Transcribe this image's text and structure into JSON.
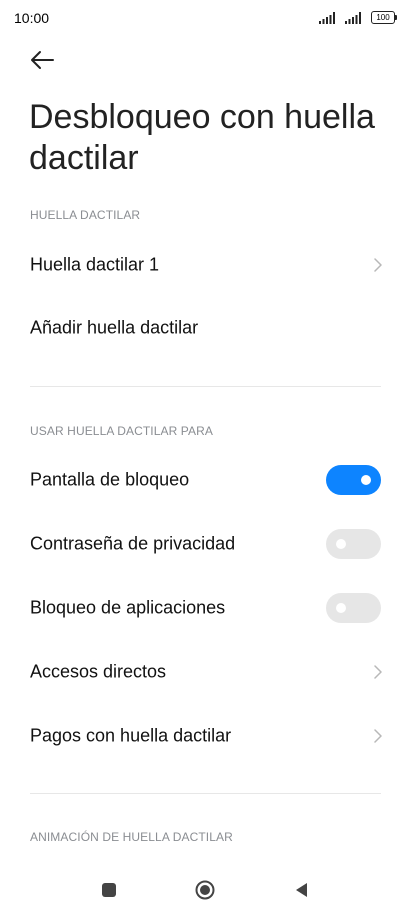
{
  "status_bar": {
    "time": "10:00",
    "battery": "100"
  },
  "header": {
    "title": "Desbloqueo con huella dactilar"
  },
  "sections": {
    "fingerprint": {
      "label": "HUELLA DACTILAR",
      "items": [
        {
          "label": "Huella dactilar 1",
          "control": "chevron"
        },
        {
          "label": "Añadir huella dactilar",
          "control": "none"
        }
      ]
    },
    "use_for": {
      "label": "USAR HUELLA DACTILAR PARA",
      "items": [
        {
          "label": "Pantalla de bloqueo",
          "control": "toggle",
          "on": true
        },
        {
          "label": "Contraseña de privacidad",
          "control": "toggle",
          "on": false
        },
        {
          "label": "Bloqueo de aplicaciones",
          "control": "toggle",
          "on": false
        },
        {
          "label": "Accesos directos",
          "control": "chevron"
        },
        {
          "label": "Pagos con huella dactilar",
          "control": "chevron"
        }
      ]
    },
    "animation": {
      "label": "ANIMACIÓN DE HUELLA DACTILAR"
    }
  },
  "colors": {
    "accent": "#0d84ff",
    "toggle_off": "#e6e6e6",
    "section_label": "#8a8d92"
  },
  "icons": {
    "back": "arrow-left-icon",
    "chevron": "chevron-right-icon",
    "nav_recents": "square-icon",
    "nav_home": "circle-icon",
    "nav_back": "triangle-back-icon"
  }
}
